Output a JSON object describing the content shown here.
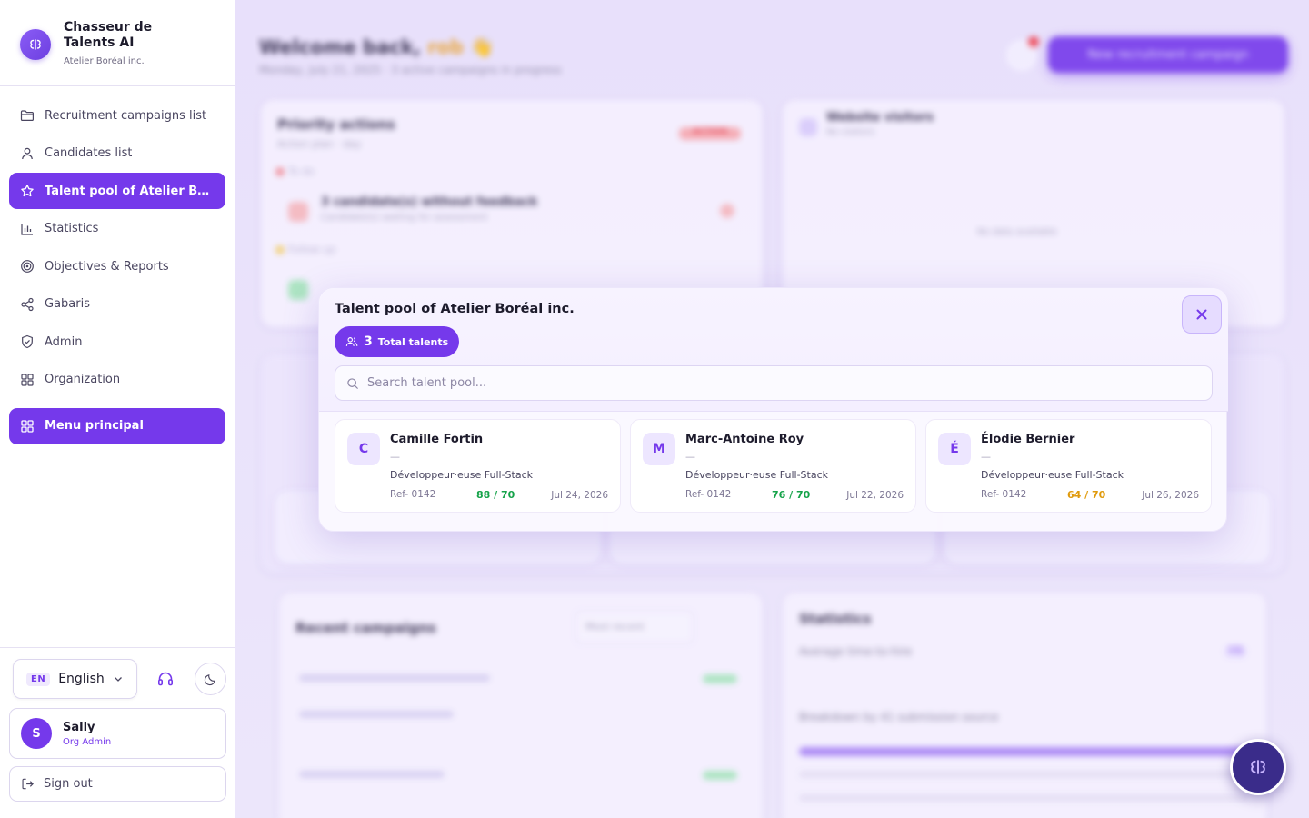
{
  "brand": {
    "title": "Chasseur de Talents AI",
    "subtitle": "Atelier Boréal inc."
  },
  "sidebar": {
    "items": [
      {
        "label": "Recruitment campaigns list",
        "icon": "folder-icon"
      },
      {
        "label": "Candidates list",
        "icon": "user-icon"
      },
      {
        "label": "Talent pool of Atelier Boréal inc.",
        "icon": "star-icon"
      },
      {
        "label": "Statistics",
        "icon": "bar-chart-icon"
      },
      {
        "label": "Objectives & Reports",
        "icon": "target-icon"
      },
      {
        "label": "Gabaris",
        "icon": "share-icon"
      },
      {
        "label": "Admin",
        "icon": "shield-icon"
      },
      {
        "label": "Organization",
        "icon": "grid-icon"
      }
    ],
    "main_menu": "Menu principal",
    "active_index": 2
  },
  "language": {
    "code": "EN",
    "name": "English"
  },
  "user": {
    "initial": "S",
    "name": "Sally",
    "role": "Org Admin"
  },
  "signout_label": "Sign out",
  "background": {
    "greeting": "Welcome back,",
    "greeting_name": "rob",
    "subtitle": "Monday, July 21, 2025 · 3 active campaigns in progress",
    "new_campaign": "New recruitment campaign",
    "priority_title": "Priority actions",
    "priority_sub": "Action plan · day",
    "priority_badge": "ACTION",
    "to_do": "To do",
    "action_row": "3 candidate(s) without feedback",
    "action_sub": "Candidate(s) waiting for assessment",
    "follow_up": "Follow up",
    "visitor_title": "Website visitors",
    "visitor_sub": "No visitors",
    "no_data": "No data available",
    "recent_title": "Recent campaigns",
    "recent_filter": "Most recent",
    "stats_title": "Statistics",
    "avg_label": "Average time-to-hire",
    "stat_value": "12j",
    "breakdown": "Breakdown by 41 submission source"
  },
  "modal": {
    "title": "Talent pool of Atelier Boréal inc.",
    "total_count": "3",
    "total_label": "Total talents",
    "search_placeholder": "Search talent pool...",
    "talents": [
      {
        "initial": "C",
        "name": "Camille Fortin",
        "dash": "—",
        "role": "Développeur·euse Full-Stack",
        "ref": "Ref- 0142",
        "score": "88 / 70",
        "score_color": "#16a34a",
        "date": "Jul 24, 2026"
      },
      {
        "initial": "M",
        "name": "Marc-Antoine Roy",
        "dash": "—",
        "role": "Développeur·euse Full-Stack",
        "ref": "Ref- 0142",
        "score": "76 / 70",
        "score_color": "#16a34a",
        "date": "Jul 22, 2026"
      },
      {
        "initial": "É",
        "name": "Élodie Bernier",
        "dash": "—",
        "role": "Développeur·euse Full-Stack",
        "ref": "Ref- 0142",
        "score": "64 / 70",
        "score_color": "#e09a0b",
        "date": "Jul 26, 2026"
      }
    ]
  },
  "colors": {
    "accent": "#7539eb",
    "good": "#16a34a",
    "warn": "#e09a0b",
    "danger": "#ef4452"
  }
}
